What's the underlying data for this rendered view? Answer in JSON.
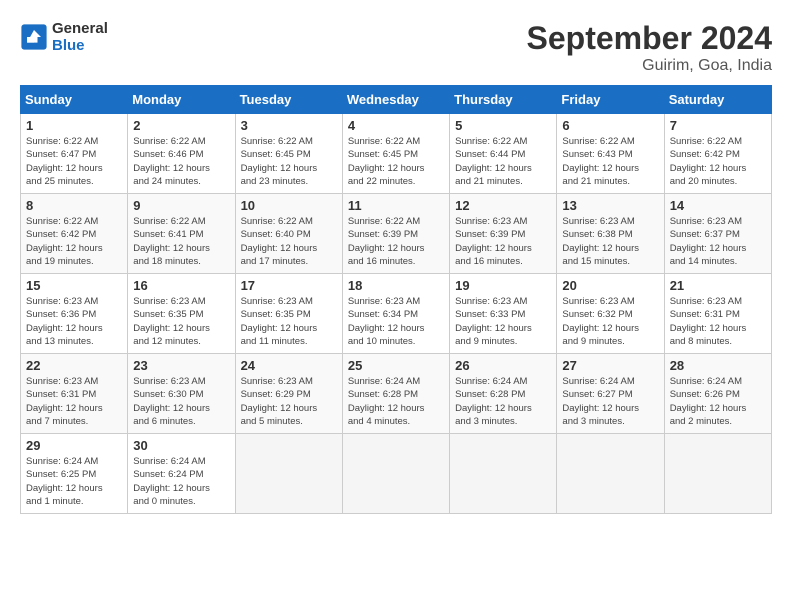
{
  "logo": {
    "line1": "General",
    "line2": "Blue"
  },
  "header": {
    "month_year": "September 2024",
    "location": "Guirim, Goa, India"
  },
  "days_of_week": [
    "Sunday",
    "Monday",
    "Tuesday",
    "Wednesday",
    "Thursday",
    "Friday",
    "Saturday"
  ],
  "weeks": [
    [
      {
        "num": "1",
        "sunrise": "6:22 AM",
        "sunset": "6:47 PM",
        "daylight": "12 hours and 25 minutes."
      },
      {
        "num": "2",
        "sunrise": "6:22 AM",
        "sunset": "6:46 PM",
        "daylight": "12 hours and 24 minutes."
      },
      {
        "num": "3",
        "sunrise": "6:22 AM",
        "sunset": "6:45 PM",
        "daylight": "12 hours and 23 minutes."
      },
      {
        "num": "4",
        "sunrise": "6:22 AM",
        "sunset": "6:45 PM",
        "daylight": "12 hours and 22 minutes."
      },
      {
        "num": "5",
        "sunrise": "6:22 AM",
        "sunset": "6:44 PM",
        "daylight": "12 hours and 21 minutes."
      },
      {
        "num": "6",
        "sunrise": "6:22 AM",
        "sunset": "6:43 PM",
        "daylight": "12 hours and 21 minutes."
      },
      {
        "num": "7",
        "sunrise": "6:22 AM",
        "sunset": "6:42 PM",
        "daylight": "12 hours and 20 minutes."
      }
    ],
    [
      {
        "num": "8",
        "sunrise": "6:22 AM",
        "sunset": "6:42 PM",
        "daylight": "12 hours and 19 minutes."
      },
      {
        "num": "9",
        "sunrise": "6:22 AM",
        "sunset": "6:41 PM",
        "daylight": "12 hours and 18 minutes."
      },
      {
        "num": "10",
        "sunrise": "6:22 AM",
        "sunset": "6:40 PM",
        "daylight": "12 hours and 17 minutes."
      },
      {
        "num": "11",
        "sunrise": "6:22 AM",
        "sunset": "6:39 PM",
        "daylight": "12 hours and 16 minutes."
      },
      {
        "num": "12",
        "sunrise": "6:23 AM",
        "sunset": "6:39 PM",
        "daylight": "12 hours and 16 minutes."
      },
      {
        "num": "13",
        "sunrise": "6:23 AM",
        "sunset": "6:38 PM",
        "daylight": "12 hours and 15 minutes."
      },
      {
        "num": "14",
        "sunrise": "6:23 AM",
        "sunset": "6:37 PM",
        "daylight": "12 hours and 14 minutes."
      }
    ],
    [
      {
        "num": "15",
        "sunrise": "6:23 AM",
        "sunset": "6:36 PM",
        "daylight": "12 hours and 13 minutes."
      },
      {
        "num": "16",
        "sunrise": "6:23 AM",
        "sunset": "6:35 PM",
        "daylight": "12 hours and 12 minutes."
      },
      {
        "num": "17",
        "sunrise": "6:23 AM",
        "sunset": "6:35 PM",
        "daylight": "12 hours and 11 minutes."
      },
      {
        "num": "18",
        "sunrise": "6:23 AM",
        "sunset": "6:34 PM",
        "daylight": "12 hours and 10 minutes."
      },
      {
        "num": "19",
        "sunrise": "6:23 AM",
        "sunset": "6:33 PM",
        "daylight": "12 hours and 9 minutes."
      },
      {
        "num": "20",
        "sunrise": "6:23 AM",
        "sunset": "6:32 PM",
        "daylight": "12 hours and 9 minutes."
      },
      {
        "num": "21",
        "sunrise": "6:23 AM",
        "sunset": "6:31 PM",
        "daylight": "12 hours and 8 minutes."
      }
    ],
    [
      {
        "num": "22",
        "sunrise": "6:23 AM",
        "sunset": "6:31 PM",
        "daylight": "12 hours and 7 minutes."
      },
      {
        "num": "23",
        "sunrise": "6:23 AM",
        "sunset": "6:30 PM",
        "daylight": "12 hours and 6 minutes."
      },
      {
        "num": "24",
        "sunrise": "6:23 AM",
        "sunset": "6:29 PM",
        "daylight": "12 hours and 5 minutes."
      },
      {
        "num": "25",
        "sunrise": "6:24 AM",
        "sunset": "6:28 PM",
        "daylight": "12 hours and 4 minutes."
      },
      {
        "num": "26",
        "sunrise": "6:24 AM",
        "sunset": "6:28 PM",
        "daylight": "12 hours and 3 minutes."
      },
      {
        "num": "27",
        "sunrise": "6:24 AM",
        "sunset": "6:27 PM",
        "daylight": "12 hours and 3 minutes."
      },
      {
        "num": "28",
        "sunrise": "6:24 AM",
        "sunset": "6:26 PM",
        "daylight": "12 hours and 2 minutes."
      }
    ],
    [
      {
        "num": "29",
        "sunrise": "6:24 AM",
        "sunset": "6:25 PM",
        "daylight": "12 hours and 1 minute."
      },
      {
        "num": "30",
        "sunrise": "6:24 AM",
        "sunset": "6:24 PM",
        "daylight": "12 hours and 0 minutes."
      },
      null,
      null,
      null,
      null,
      null
    ]
  ]
}
